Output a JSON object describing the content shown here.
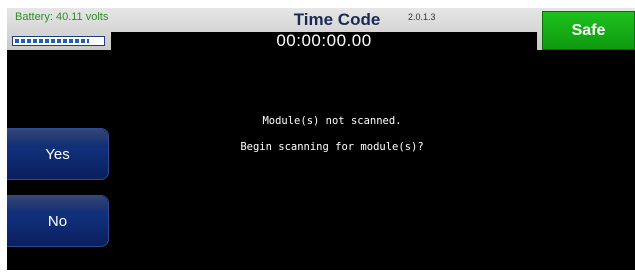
{
  "header": {
    "battery_label": "Battery: 40.11 volts",
    "battery_level_fraction": 0.85,
    "title": "Time Code",
    "version": "2.0.1.3",
    "timecode": "00:00:00.00",
    "safe_label": "Safe"
  },
  "dialog": {
    "line1": "Module(s) not scanned.",
    "line2": "Begin scanning for module(s)?"
  },
  "buttons": {
    "yes_label": "Yes",
    "no_label": "No"
  },
  "colors": {
    "safe": "#18b418",
    "button_blue": "#0d2566",
    "battery_text": "#2e8f28"
  }
}
